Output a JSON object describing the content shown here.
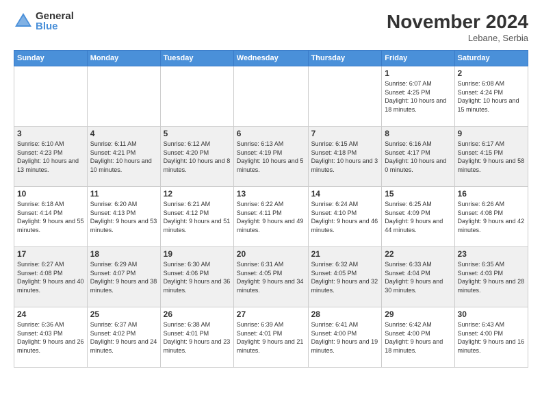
{
  "header": {
    "logo_general": "General",
    "logo_blue": "Blue",
    "month_title": "November 2024",
    "subtitle": "Lebane, Serbia"
  },
  "days_of_week": [
    "Sunday",
    "Monday",
    "Tuesday",
    "Wednesday",
    "Thursday",
    "Friday",
    "Saturday"
  ],
  "weeks": [
    [
      {
        "day": "",
        "info": ""
      },
      {
        "day": "",
        "info": ""
      },
      {
        "day": "",
        "info": ""
      },
      {
        "day": "",
        "info": ""
      },
      {
        "day": "",
        "info": ""
      },
      {
        "day": "1",
        "info": "Sunrise: 6:07 AM\nSunset: 4:25 PM\nDaylight: 10 hours and 18 minutes."
      },
      {
        "day": "2",
        "info": "Sunrise: 6:08 AM\nSunset: 4:24 PM\nDaylight: 10 hours and 15 minutes."
      }
    ],
    [
      {
        "day": "3",
        "info": "Sunrise: 6:10 AM\nSunset: 4:23 PM\nDaylight: 10 hours and 13 minutes."
      },
      {
        "day": "4",
        "info": "Sunrise: 6:11 AM\nSunset: 4:21 PM\nDaylight: 10 hours and 10 minutes."
      },
      {
        "day": "5",
        "info": "Sunrise: 6:12 AM\nSunset: 4:20 PM\nDaylight: 10 hours and 8 minutes."
      },
      {
        "day": "6",
        "info": "Sunrise: 6:13 AM\nSunset: 4:19 PM\nDaylight: 10 hours and 5 minutes."
      },
      {
        "day": "7",
        "info": "Sunrise: 6:15 AM\nSunset: 4:18 PM\nDaylight: 10 hours and 3 minutes."
      },
      {
        "day": "8",
        "info": "Sunrise: 6:16 AM\nSunset: 4:17 PM\nDaylight: 10 hours and 0 minutes."
      },
      {
        "day": "9",
        "info": "Sunrise: 6:17 AM\nSunset: 4:15 PM\nDaylight: 9 hours and 58 minutes."
      }
    ],
    [
      {
        "day": "10",
        "info": "Sunrise: 6:18 AM\nSunset: 4:14 PM\nDaylight: 9 hours and 55 minutes."
      },
      {
        "day": "11",
        "info": "Sunrise: 6:20 AM\nSunset: 4:13 PM\nDaylight: 9 hours and 53 minutes."
      },
      {
        "day": "12",
        "info": "Sunrise: 6:21 AM\nSunset: 4:12 PM\nDaylight: 9 hours and 51 minutes."
      },
      {
        "day": "13",
        "info": "Sunrise: 6:22 AM\nSunset: 4:11 PM\nDaylight: 9 hours and 49 minutes."
      },
      {
        "day": "14",
        "info": "Sunrise: 6:24 AM\nSunset: 4:10 PM\nDaylight: 9 hours and 46 minutes."
      },
      {
        "day": "15",
        "info": "Sunrise: 6:25 AM\nSunset: 4:09 PM\nDaylight: 9 hours and 44 minutes."
      },
      {
        "day": "16",
        "info": "Sunrise: 6:26 AM\nSunset: 4:08 PM\nDaylight: 9 hours and 42 minutes."
      }
    ],
    [
      {
        "day": "17",
        "info": "Sunrise: 6:27 AM\nSunset: 4:08 PM\nDaylight: 9 hours and 40 minutes."
      },
      {
        "day": "18",
        "info": "Sunrise: 6:29 AM\nSunset: 4:07 PM\nDaylight: 9 hours and 38 minutes."
      },
      {
        "day": "19",
        "info": "Sunrise: 6:30 AM\nSunset: 4:06 PM\nDaylight: 9 hours and 36 minutes."
      },
      {
        "day": "20",
        "info": "Sunrise: 6:31 AM\nSunset: 4:05 PM\nDaylight: 9 hours and 34 minutes."
      },
      {
        "day": "21",
        "info": "Sunrise: 6:32 AM\nSunset: 4:05 PM\nDaylight: 9 hours and 32 minutes."
      },
      {
        "day": "22",
        "info": "Sunrise: 6:33 AM\nSunset: 4:04 PM\nDaylight: 9 hours and 30 minutes."
      },
      {
        "day": "23",
        "info": "Sunrise: 6:35 AM\nSunset: 4:03 PM\nDaylight: 9 hours and 28 minutes."
      }
    ],
    [
      {
        "day": "24",
        "info": "Sunrise: 6:36 AM\nSunset: 4:03 PM\nDaylight: 9 hours and 26 minutes."
      },
      {
        "day": "25",
        "info": "Sunrise: 6:37 AM\nSunset: 4:02 PM\nDaylight: 9 hours and 24 minutes."
      },
      {
        "day": "26",
        "info": "Sunrise: 6:38 AM\nSunset: 4:01 PM\nDaylight: 9 hours and 23 minutes."
      },
      {
        "day": "27",
        "info": "Sunrise: 6:39 AM\nSunset: 4:01 PM\nDaylight: 9 hours and 21 minutes."
      },
      {
        "day": "28",
        "info": "Sunrise: 6:41 AM\nSunset: 4:00 PM\nDaylight: 9 hours and 19 minutes."
      },
      {
        "day": "29",
        "info": "Sunrise: 6:42 AM\nSunset: 4:00 PM\nDaylight: 9 hours and 18 minutes."
      },
      {
        "day": "30",
        "info": "Sunrise: 6:43 AM\nSunset: 4:00 PM\nDaylight: 9 hours and 16 minutes."
      }
    ]
  ]
}
